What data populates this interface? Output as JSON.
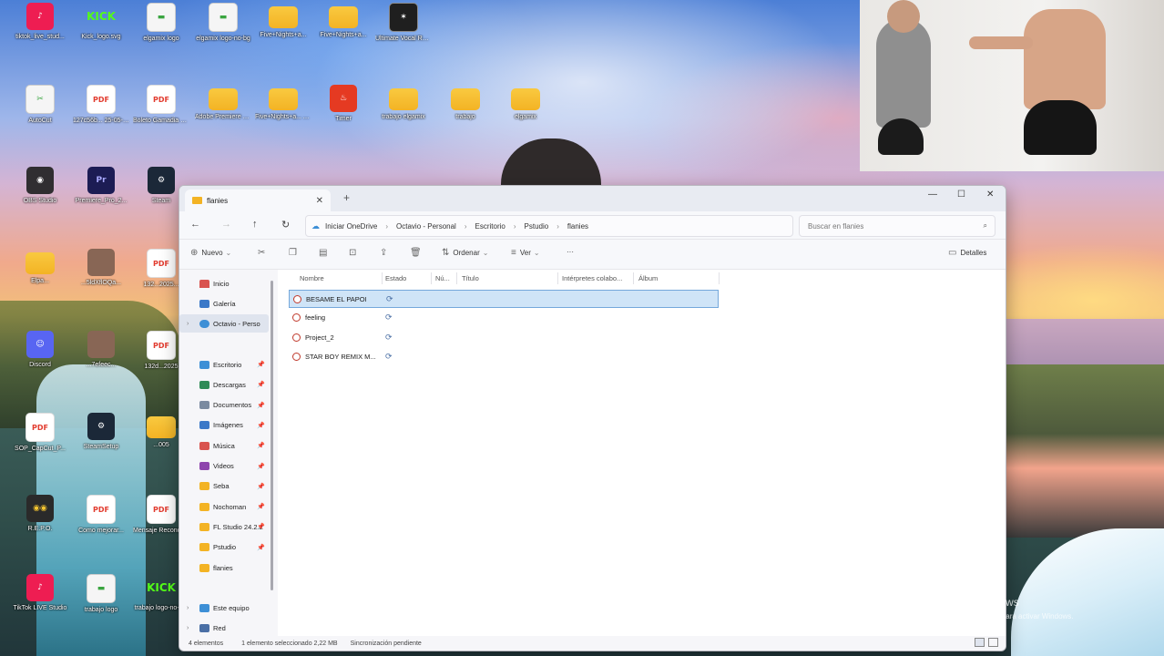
{
  "desktop": {
    "icons": [
      {
        "label": "tiktok_live_stud...",
        "glyph": "♪",
        "kind": "tiktok"
      },
      {
        "label": "Kick_logo.svg",
        "glyph": "KICK",
        "kind": "kick"
      },
      {
        "label": "elgamix logo",
        "glyph": "▬",
        "kind": "doc"
      },
      {
        "label": "elgamix logo-no-bg",
        "glyph": "▬",
        "kind": "doc"
      },
      {
        "label": "Five+Nights+a...",
        "glyph": "",
        "kind": "folder"
      },
      {
        "label": "Five+Nights+a...",
        "glyph": "",
        "kind": "folder"
      },
      {
        "label": "Ultimate Vocal Remover",
        "glyph": "✶",
        "kind": "vocal"
      },
      {
        "label": "AutoCut",
        "glyph": "✂",
        "kind": "doc"
      },
      {
        "label": "127c56b... 25-05-2025...",
        "glyph": "PDF",
        "kind": "pdf"
      },
      {
        "label": "Boleto Gamadia 07...",
        "glyph": "PDF",
        "kind": "pdf"
      },
      {
        "label": "Adobe Premiere Pro 2025 Gam...",
        "glyph": "",
        "kind": "folder"
      },
      {
        "label": "Five+Nights+a... Angel Gand...",
        "glyph": "",
        "kind": "folder"
      },
      {
        "label": "Timer",
        "glyph": "♨",
        "kind": "red"
      },
      {
        "label": "trabajo elgamix",
        "glyph": "",
        "kind": "folder"
      },
      {
        "label": "trabajo",
        "glyph": "",
        "kind": "folder"
      },
      {
        "label": "elgamix",
        "glyph": "",
        "kind": "folder"
      },
      {
        "label": "OBS Studio",
        "glyph": "◉",
        "kind": "obs"
      },
      {
        "label": "Premiere_Pro_2...",
        "glyph": "Pr",
        "kind": "pr"
      },
      {
        "label": "Steam",
        "glyph": "⚙",
        "kind": "steam"
      },
      {
        "label": "Elpa...",
        "glyph": "",
        "kind": "folder"
      },
      {
        "label": "...5ldXflOQa...",
        "glyph": "",
        "kind": "pic"
      },
      {
        "label": "132...2025...",
        "glyph": "PDF",
        "kind": "pdf"
      },
      {
        "label": "Discord",
        "glyph": "☺",
        "kind": "discord"
      },
      {
        "label": "...7efeec...",
        "glyph": "",
        "kind": "pic"
      },
      {
        "label": "132d...2025",
        "glyph": "PDF",
        "kind": "pdf"
      },
      {
        "label": "SOP_CapCut_P...",
        "glyph": "PDF",
        "kind": "pdf"
      },
      {
        "label": "SteamSetup",
        "glyph": "⚙",
        "kind": "steam"
      },
      {
        "label": "...005",
        "glyph": "",
        "kind": "folder"
      },
      {
        "label": "R.E.P.O.",
        "glyph": "◉◉",
        "kind": "repo"
      },
      {
        "label": "Como mejorar...",
        "glyph": "PDF",
        "kind": "pdf"
      },
      {
        "label": "Mensaje Reconocim...",
        "glyph": "PDF",
        "kind": "pdf"
      },
      {
        "label": "TikTok LIVE Studio",
        "glyph": "♪",
        "kind": "tiktok"
      },
      {
        "label": "trabajo logo",
        "glyph": "▬",
        "kind": "doc"
      },
      {
        "label": "trabajo logo-no-b...",
        "glyph": "KICK",
        "kind": "kick"
      }
    ],
    "activate_windows": {
      "title": "Activar Windows",
      "sub": "Ve a Configuración para activar Windows."
    }
  },
  "explorer": {
    "tab_title": "flanies",
    "address": [
      "Iniciar OneDrive",
      "Octavio - Personal",
      "Escritorio",
      "Pstudio",
      "flanies"
    ],
    "search_placeholder": "Buscar en flanies",
    "toolbar": {
      "new": "Nuevo",
      "sort": "Ordenar",
      "view": "Ver",
      "more": "···",
      "details": "Detalles"
    },
    "nav": {
      "inicio": "Inicio",
      "galeria": "Galería",
      "onedrive": "Octavio - Perso",
      "quick": [
        {
          "label": "Escritorio",
          "color": "#3d8fd6"
        },
        {
          "label": "Descargas",
          "color": "#2e8b57"
        },
        {
          "label": "Documentos",
          "color": "#7a8aa0"
        },
        {
          "label": "Imágenes",
          "color": "#3b78c8"
        },
        {
          "label": "Música",
          "color": "#d9534f"
        },
        {
          "label": "Videos",
          "color": "#8e44ad"
        },
        {
          "label": "Seba",
          "color": "#f3b324"
        },
        {
          "label": "Nochoman",
          "color": "#f3b324"
        },
        {
          "label": "FL Studio 24.2.2",
          "color": "#f3b324"
        },
        {
          "label": "Pstudio",
          "color": "#f3b324"
        },
        {
          "label": "flanies",
          "color": "#f3b324"
        }
      ],
      "este_equipo": "Este equipo",
      "red": "Red"
    },
    "columns": [
      "Nombre",
      "Estado",
      "Nú...",
      "Título",
      "Intérpretes colabo...",
      "Álbum"
    ],
    "files": [
      {
        "name": "BESAME EL PAPOI",
        "status": "⟳",
        "selected": true
      },
      {
        "name": "feeling",
        "status": "⟳",
        "selected": false
      },
      {
        "name": "Project_2",
        "status": "⟳",
        "selected": false
      },
      {
        "name": "STAR BOY REMIX M...",
        "status": "⟳",
        "selected": false
      }
    ],
    "status": {
      "count": "4 elementos",
      "selection": "1 elemento seleccionado  2,22 MB",
      "sync": "Sincronización pendiente"
    }
  }
}
